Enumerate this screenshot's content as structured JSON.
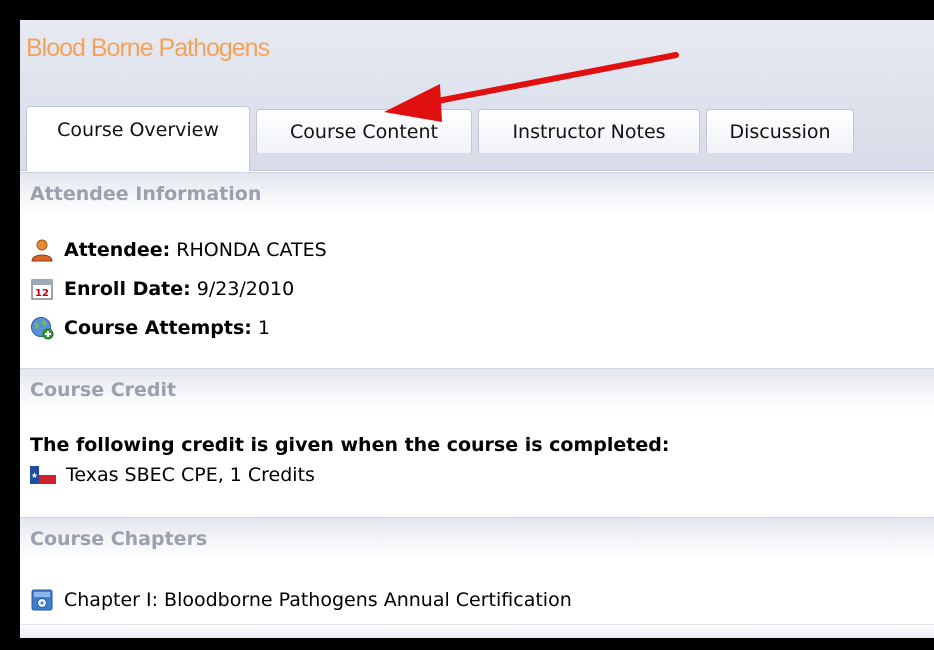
{
  "app": {
    "title": "Blood Borne Pathogens"
  },
  "tabs": [
    {
      "label": "Course Overview"
    },
    {
      "label": "Course Content"
    },
    {
      "label": "Instructor Notes"
    },
    {
      "label": "Discussion"
    }
  ],
  "attendee_section": {
    "title": "Attendee Information",
    "attendee_label": "Attendee:",
    "attendee_value": "RHONDA CATES",
    "enroll_label": "Enroll Date:",
    "enroll_value": "9/23/2010",
    "attempts_label": "Course Attempts:",
    "attempts_value": "1"
  },
  "credit_section": {
    "title": "Course Credit",
    "heading": "The following credit is given when the course is completed:",
    "credit_item": "Texas SBEC CPE, 1 Credits"
  },
  "chapters_section": {
    "title": "Course Chapters",
    "chapters": [
      {
        "label": "Chapter I: Bloodborne Pathogens Annual Certification"
      }
    ]
  },
  "colors": {
    "title_orange": "#f3a35a",
    "section_title_gray": "#9aa0ae",
    "arrow_red": "#e01010"
  },
  "icons": {
    "attendee": "user-icon",
    "enroll": "calendar-icon",
    "attempts": "globe-icon",
    "credit": "texas-flag-icon",
    "chapter": "chapter-icon"
  }
}
